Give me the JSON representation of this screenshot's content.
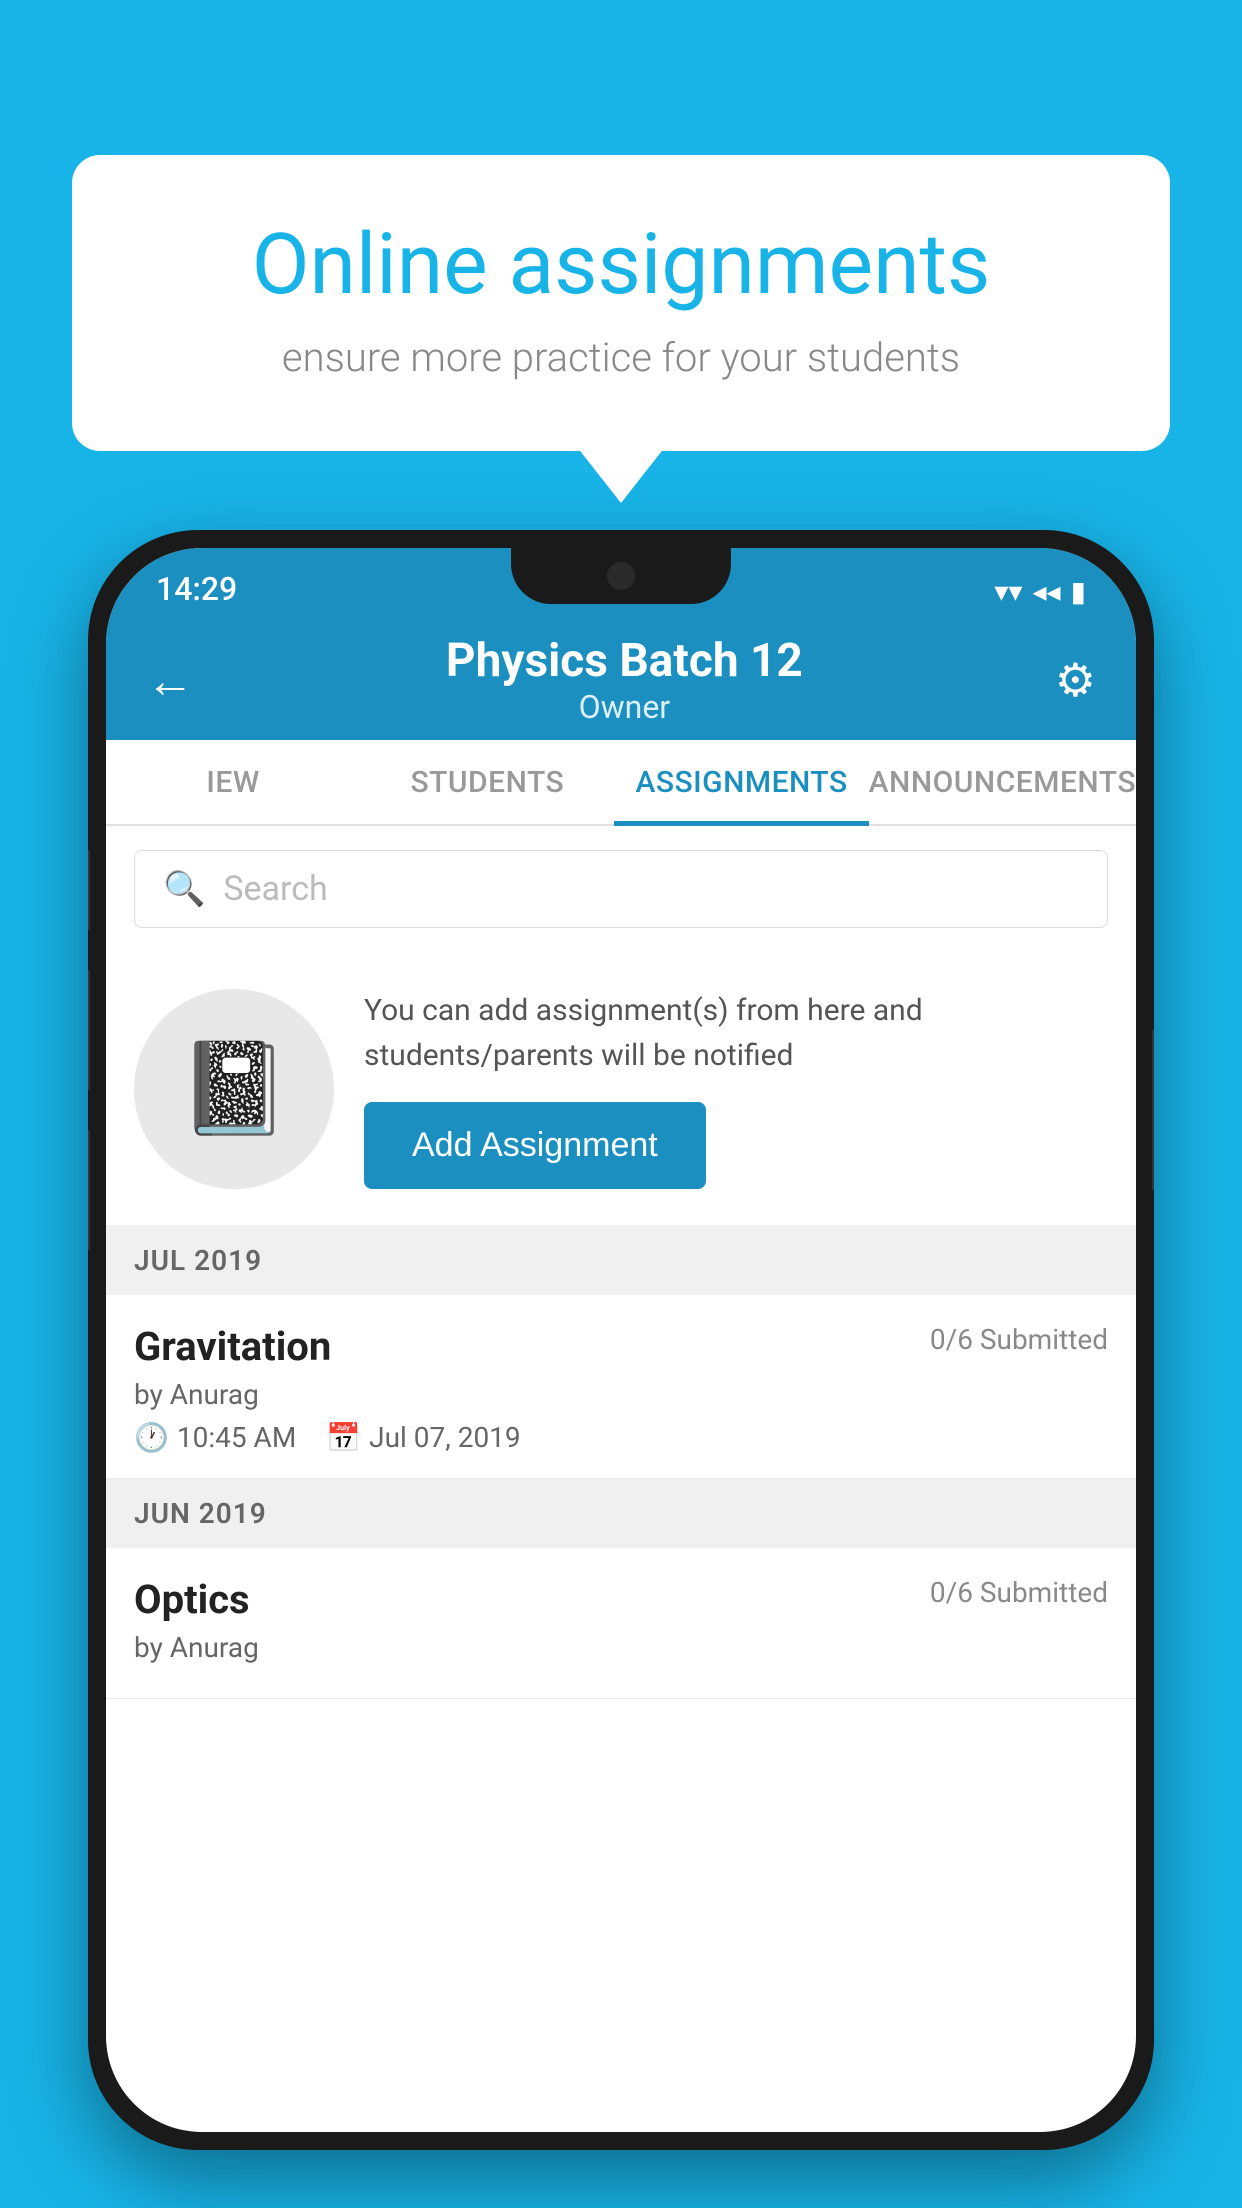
{
  "background_color": "#18b4e8",
  "speech_bubble": {
    "title": "Online assignments",
    "subtitle": "ensure more practice for your students"
  },
  "status_bar": {
    "time": "14:29",
    "wifi_icon": "▾",
    "signal_icon": "◂",
    "battery_icon": "▮"
  },
  "app_bar": {
    "title": "Physics Batch 12",
    "subtitle": "Owner",
    "back_label": "←",
    "settings_label": "⚙"
  },
  "tabs": [
    {
      "label": "IEW",
      "active": false
    },
    {
      "label": "STUDENTS",
      "active": false
    },
    {
      "label": "ASSIGNMENTS",
      "active": true
    },
    {
      "label": "ANNOUNCEMENTS",
      "active": false
    }
  ],
  "search": {
    "placeholder": "Search"
  },
  "prompt": {
    "description": "You can add assignment(s) from here and students/parents will be notified",
    "add_button_label": "Add Assignment"
  },
  "sections": [
    {
      "header": "JUL 2019",
      "assignments": [
        {
          "title": "Gravitation",
          "submitted": "0/6 Submitted",
          "by": "by Anurag",
          "time": "10:45 AM",
          "date": "Jul 07, 2019"
        }
      ]
    },
    {
      "header": "JUN 2019",
      "assignments": [
        {
          "title": "Optics",
          "submitted": "0/6 Submitted",
          "by": "by Anurag",
          "time": "",
          "date": ""
        }
      ]
    }
  ]
}
